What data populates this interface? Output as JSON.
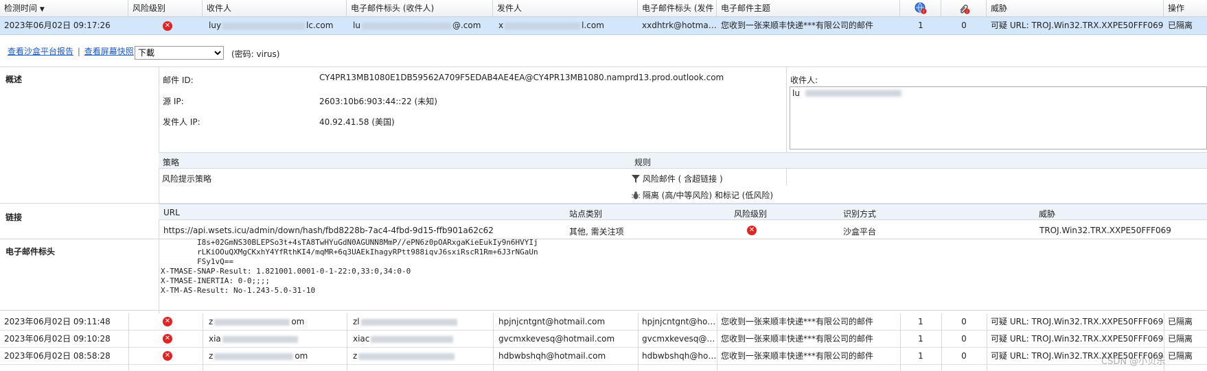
{
  "columns": {
    "detect_time": "检测时间",
    "sort_arrow": "▼",
    "risk_level": "风险级别",
    "recipient": "收件人",
    "header_recipient": "电子邮件标头 (收件人)",
    "sender": "发件人",
    "header_sender": "电子邮件标头 (发件",
    "subject": "电子邮件主题",
    "threat": "威胁",
    "action": "操作"
  },
  "selected_row": {
    "time": "2023年06月02日 09:17:26",
    "recipient_prefix": "luy",
    "recipient_suffix": "lc.com",
    "header_recipient_prefix": "lu",
    "header_recipient_suffix": "@.com",
    "sender_prefix": "x",
    "sender_suffix": "l.com",
    "header_sender": "xxdhtrk@hotmail.com",
    "subject": "您收到一张来顺丰快递***有限公司的邮件",
    "count1": "1",
    "count2": "0",
    "threat": "可疑 URL: TROJ.Win32.TRX.XXPE50FFF069",
    "action": "已隔离"
  },
  "detail": {
    "sandbox_report": "查看沙盒平台报告",
    "separator": "|",
    "screenshot": "查看屏幕快照",
    "download_selected": "下載",
    "password_note": "(密码: virus)",
    "overview_label": "概述",
    "mail_id_label": "邮件 ID:",
    "mail_id_value": "CY4PR13MB1080E1DB59562A709F5EDAB4AE4EA@CY4PR13MB1080.namprd13.prod.outlook.com",
    "source_ip_label": "源 IP:",
    "source_ip_value": "2603:10b6:903:44::22 (未知)",
    "sender_ip_label": "发件人 IP:",
    "sender_ip_value": "40.92.41.58 (美国)",
    "recipients_label": "收件人:",
    "recipients_value": "lu",
    "policy_header": "策略",
    "rule_header": "规则",
    "policy_value": "风险提示策略",
    "rule_1": "风险邮件 ( 含超链接 )",
    "rule_2": "隔离 (高/中等风险) 和标记 (低风险)",
    "links_label": "链接",
    "link_cols": {
      "url": "URL",
      "site_category": "站点类别",
      "risk_level": "风险级别",
      "detection": "识别方式",
      "threat": "威胁"
    },
    "link_row": {
      "url": "https://api.wsets.icu/admin/down/hash/fbd8228b-7ac4-4fbd-9d15-ffb901a62c62",
      "site_category": "其他, 需关注项",
      "detection": "沙盒平台",
      "threat": "TROJ.Win32.TRX.XXPE50FFF069"
    },
    "headers_label": "电子邮件标头",
    "header_lines": "        I8s+02GmNS30BLEPSo3t+4sTA8TwHYuGdN0AGUNN8MmP//ePN6z0pOARxgaKieEukIy9n6HVYIj\n        rLKiOOuQXMgCKxhY4YfRthKI4/mqMR+6q3UAEkIhagyRPtt988iqvJ6sxiRscR1Rm+6J3rNGaUn\n        FSy1vQ==\nX-TMASE-SNAP-Result: 1.821001.0001-0-1-22:0,33:0,34:0-0\nX-TMASE-INERTIA: 0-0;;;;\nX-TM-AS-Result: No-1.243-5.0-31-10"
  },
  "rows": [
    {
      "time": "2023年06月02日 09:11:48",
      "recipient_prefix": "z",
      "recipient_suffix": "om",
      "header_recipient_prefix": "zl",
      "sender": "hpjnjcntgnt@hotmail.com",
      "header_sender": "hpjnjcntgnt@hotmail.com",
      "subject": "您收到一张来顺丰快递***有限公司的邮件",
      "count1": "1",
      "count2": "0",
      "threat": "可疑 URL: TROJ.Win32.TRX.XXPE50FFF069",
      "action": "已隔离"
    },
    {
      "time": "2023年06月02日 09:10:28",
      "recipient_prefix": "xia",
      "recipient_suffix": "",
      "header_recipient_prefix": "xiac",
      "sender": "gvcmxkevesq@hotmail.com",
      "header_sender": "gvcmxkevesq@hotmail.com",
      "subject": "您收到一张来顺丰快递***有限公司的邮件",
      "count1": "1",
      "count2": "0",
      "threat": "可疑 URL: TROJ.Win32.TRX.XXPE50FFF069",
      "action": "已隔离"
    },
    {
      "time": "2023年06月02日 08:58:28",
      "recipient_prefix": "z",
      "recipient_suffix": "om",
      "header_recipient_prefix": "z",
      "sender": "hdbwbshqh@hotmail.com",
      "header_sender": "hdbwbshqh@hotmail.com",
      "subject": "您收到一张来顺丰快递***有限公司的邮件",
      "count1": "1",
      "count2": "0",
      "threat": "可疑 URL: TROJ.Win32.TRX.XXPE50FFF069",
      "action": "已隔离"
    }
  ],
  "icons": {
    "globe": "globe-alert-icon",
    "attachment": "attachment-alert-icon",
    "risk": "risk-high-icon",
    "filter": "filter-icon",
    "quarantine": "quarantine-bug-icon"
  },
  "colors": {
    "risk_red": "#e02424",
    "selected_row": "#d3e6fa",
    "link_blue": "#1a56c4"
  },
  "watermark": "CSDN @小贝乐"
}
